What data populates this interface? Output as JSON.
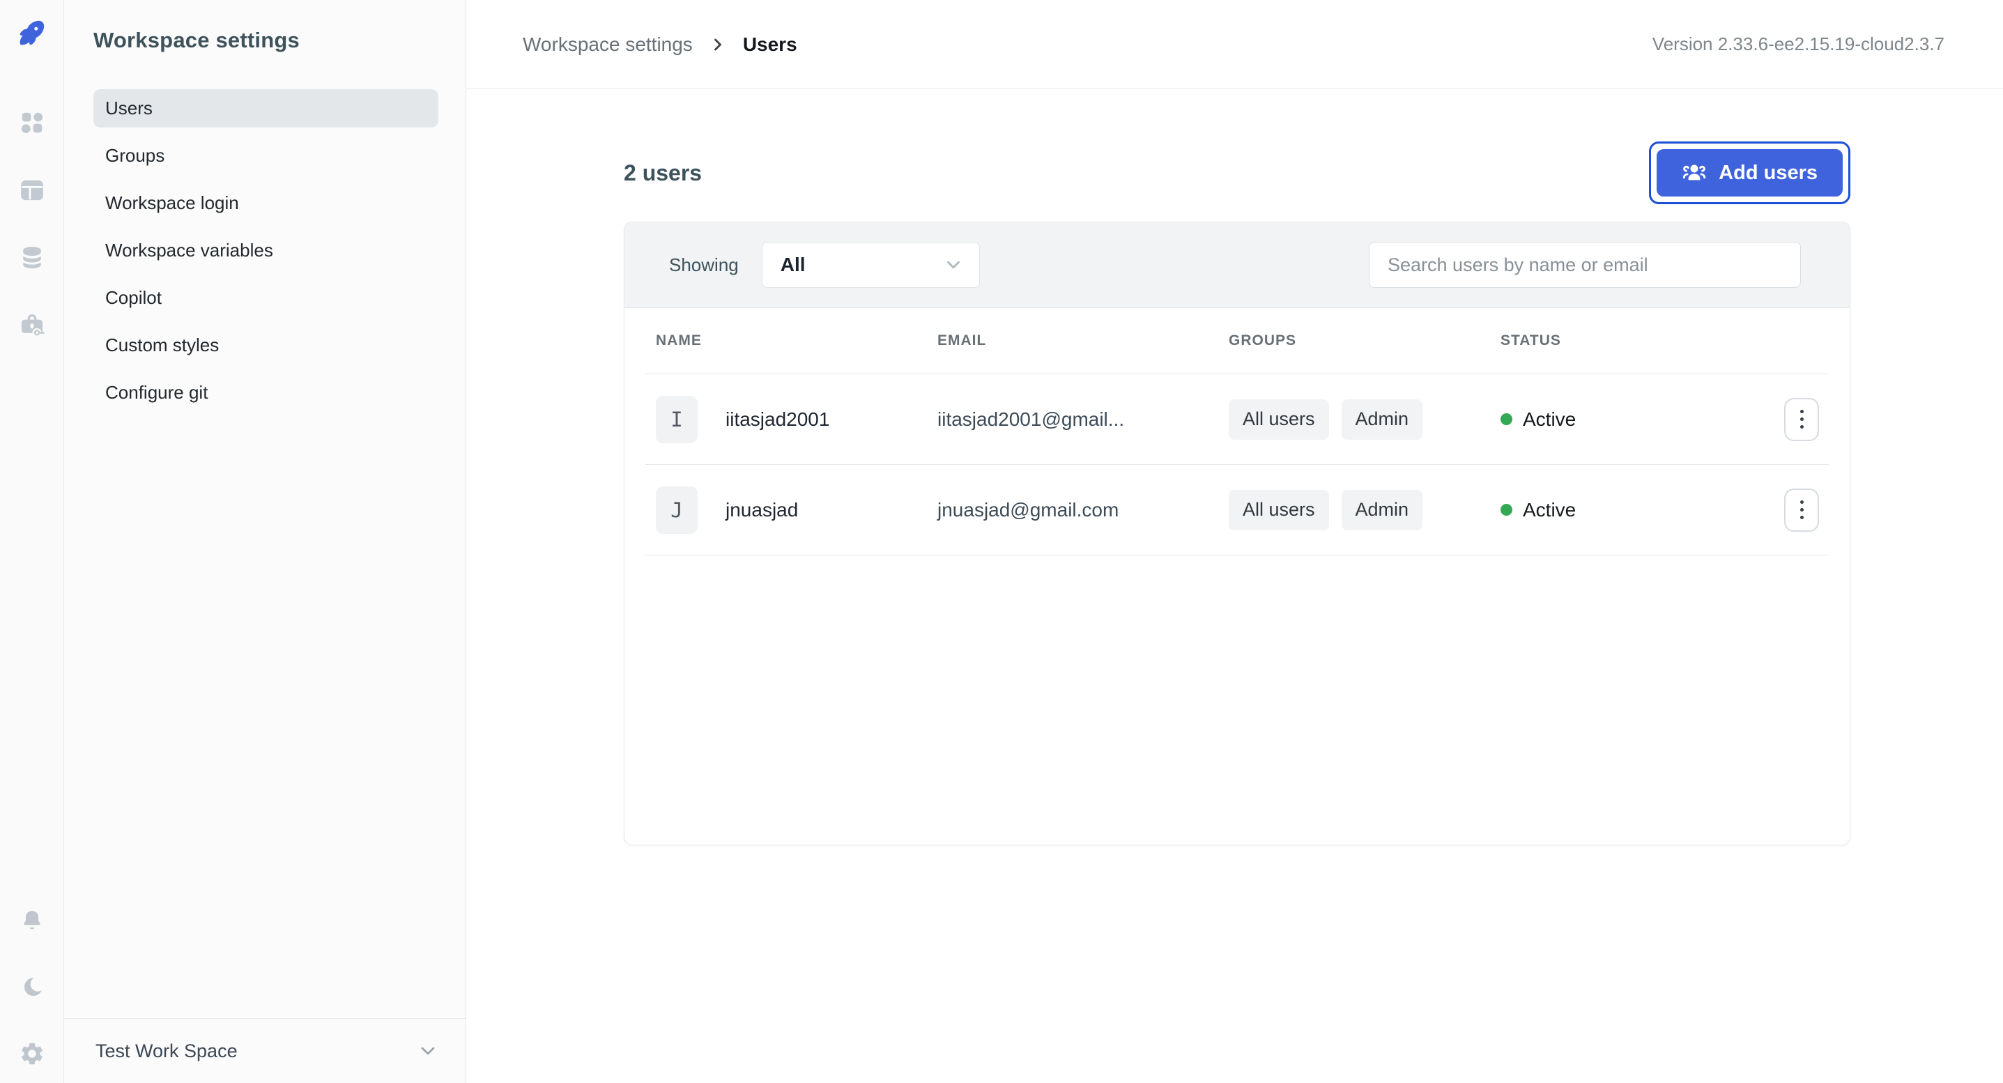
{
  "app": {
    "version": "Version 2.33.6-ee2.15.19-cloud2.3.7"
  },
  "rail": {
    "icons": [
      "rocket-logo-icon",
      "apps-icon",
      "workflows-icon",
      "data-sources-icon",
      "marketplace-icon"
    ],
    "bottom_icons": [
      "notifications-icon",
      "dark-mode-icon",
      "settings-icon"
    ]
  },
  "sidebar": {
    "title": "Workspace settings",
    "items": [
      {
        "label": "Users",
        "active": true
      },
      {
        "label": "Groups",
        "active": false
      },
      {
        "label": "Workspace login",
        "active": false
      },
      {
        "label": "Workspace variables",
        "active": false
      },
      {
        "label": "Copilot",
        "active": false
      },
      {
        "label": "Custom styles",
        "active": false
      },
      {
        "label": "Configure git",
        "active": false
      }
    ],
    "workspace_name": "Test Work Space"
  },
  "breadcrumb": {
    "parent": "Workspace settings",
    "current": "Users"
  },
  "toolbar": {
    "count_label": "2 users",
    "add_users_label": "Add users"
  },
  "filter": {
    "showing_label": "Showing",
    "selected_option": "All",
    "search_placeholder": "Search users by name or email"
  },
  "table": {
    "columns": [
      "NAME",
      "EMAIL",
      "GROUPS",
      "STATUS"
    ],
    "rows": [
      {
        "avatar": "I",
        "name": "iitasjad2001",
        "email": "iitasjad2001@gmail...",
        "groups": [
          "All users",
          "Admin"
        ],
        "status": "Active"
      },
      {
        "avatar": "J",
        "name": "jnuasjad",
        "email": "jnuasjad@gmail.com",
        "groups": [
          "All users",
          "Admin"
        ],
        "status": "Active"
      }
    ]
  },
  "colors": {
    "accent": "#3e63dd",
    "focus_ring": "#1d4fd7",
    "status_active": "#34a853"
  }
}
